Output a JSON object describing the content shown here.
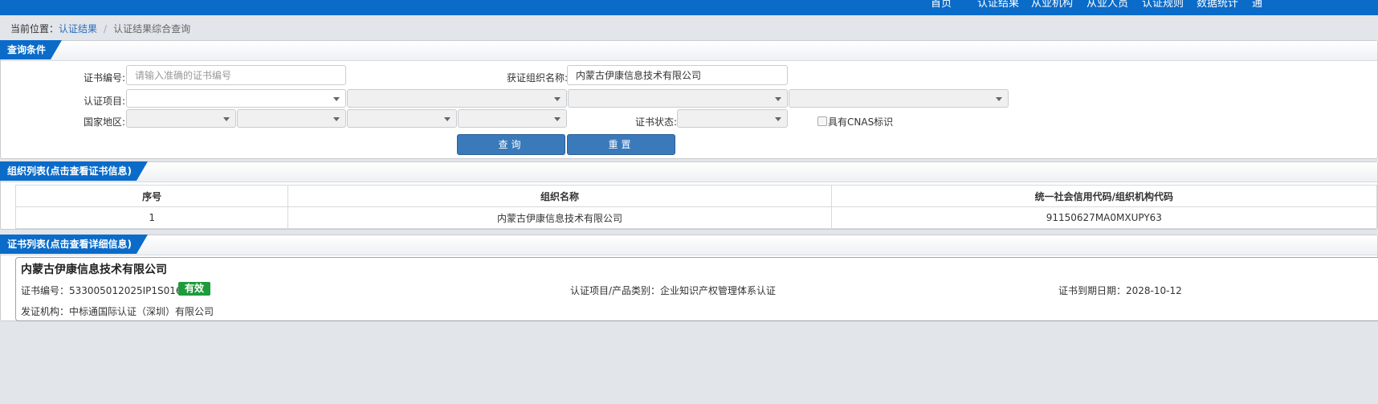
{
  "nav": {
    "items": [
      "首页",
      "认证结果",
      "从业机构",
      "从业人员",
      "认证规则",
      "数据统计",
      "通"
    ]
  },
  "breadcrumb": {
    "prefix": "当前位置：",
    "link": "认证结果",
    "separator": "/",
    "current": "认证结果综合查询"
  },
  "query": {
    "title": "查询条件",
    "cert_no_label": "证书编号:",
    "cert_no_placeholder": "请输入准确的证书编号",
    "cert_no_value": "",
    "org_name_label": "获证组织名称:",
    "org_name_value": "内蒙古伊康信息技术有限公司",
    "cert_item_label": "认证项目:",
    "region_label": "国家地区:",
    "status_label": "证书状态:",
    "cnas_label": "具有CNAS标识",
    "search_button": "查询",
    "reset_button": "重置"
  },
  "org_list": {
    "title": "组织列表(点击查看证书信息)",
    "columns": [
      "序号",
      "组织名称",
      "统一社会信用代码/组织机构代码"
    ],
    "rows": [
      [
        "1",
        "内蒙古伊康信息技术有限公司",
        "91150627MA0MXUPY63"
      ]
    ]
  },
  "cert_list": {
    "title": "证书列表(点击查看详细信息)",
    "card": {
      "org_name": "内蒙古伊康信息技术有限公司",
      "cert_no": "证书编号：533005012025IP1S0169",
      "status": "有效",
      "status_color": "#1e9b3c",
      "project": "认证项目/产品类别：企业知识产权管理体系认证",
      "expiry": "证书到期日期：2028-10-12",
      "issuer": "发证机构：中标通国际认证（深圳）有限公司"
    }
  },
  "colors": {
    "primary": "#0a6bc9",
    "button": "#3a79ba",
    "page_bg": "#e2e5e9"
  }
}
